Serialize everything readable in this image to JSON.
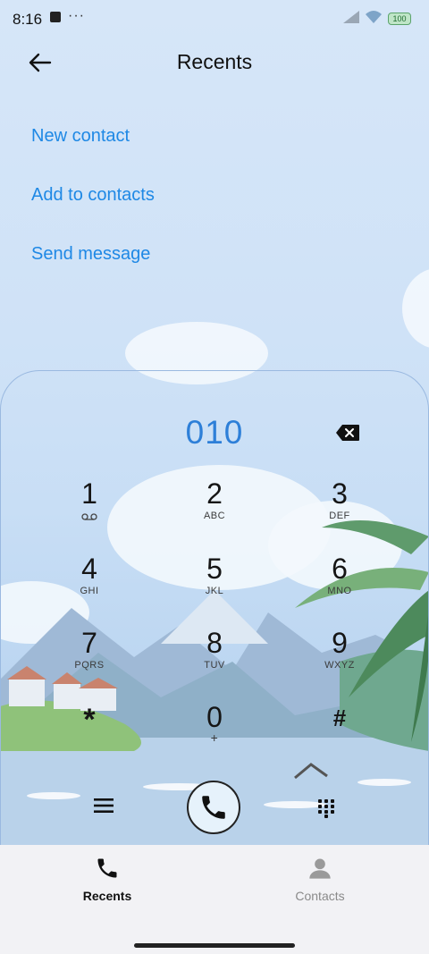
{
  "status_bar": {
    "time": "8:16",
    "more_dots": "···",
    "battery": "100"
  },
  "header": {
    "title": "Recents"
  },
  "actions": [
    {
      "label": "New contact"
    },
    {
      "label": "Add to contacts"
    },
    {
      "label": "Send message"
    }
  ],
  "dialer": {
    "number": "010",
    "keys": [
      {
        "digit": "1",
        "letters": ""
      },
      {
        "digit": "2",
        "letters": "ABC"
      },
      {
        "digit": "3",
        "letters": "DEF"
      },
      {
        "digit": "4",
        "letters": "GHI"
      },
      {
        "digit": "5",
        "letters": "JKL"
      },
      {
        "digit": "6",
        "letters": "MNO"
      },
      {
        "digit": "7",
        "letters": "PQRS"
      },
      {
        "digit": "8",
        "letters": "TUV"
      },
      {
        "digit": "9",
        "letters": "WXYZ"
      },
      {
        "digit": "*",
        "letters": ""
      },
      {
        "digit": "0",
        "letters": "+"
      },
      {
        "digit": "#",
        "letters": ""
      }
    ]
  },
  "bottom_nav": {
    "recents": {
      "label": "Recents",
      "color": "#111111"
    },
    "contacts": {
      "label": "Contacts",
      "color": "#8a8a8a"
    }
  },
  "colors": {
    "accent": "#1e88e5",
    "number": "#2d7fd8"
  }
}
